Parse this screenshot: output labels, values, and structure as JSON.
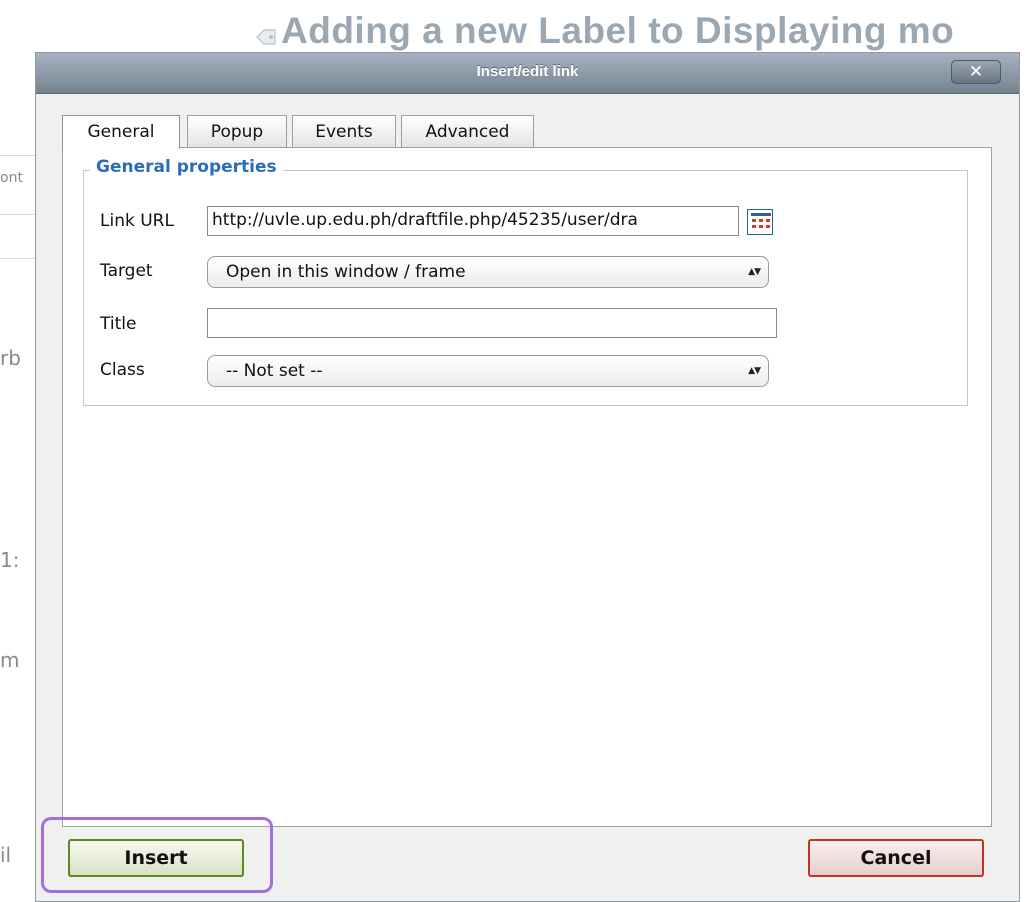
{
  "background": {
    "heading": "Adding a new Label to Displaying mo",
    "fragments": [
      "ont",
      "rb",
      "1:",
      "m",
      "il"
    ]
  },
  "dialog": {
    "title": "Insert/edit link",
    "close_label": "✕",
    "tabs": [
      "General",
      "Popup",
      "Events",
      "Advanced"
    ],
    "active_tab": "General",
    "fieldset_legend": "General properties",
    "fields": {
      "link_url": {
        "label": "Link URL",
        "value": "http://uvle.up.edu.ph/draftfile.php/45235/user/dra"
      },
      "target": {
        "label": "Target",
        "value": "Open in this window / frame"
      },
      "title": {
        "label": "Title",
        "value": ""
      },
      "class": {
        "label": "Class",
        "value": "-- Not set --"
      }
    },
    "buttons": {
      "insert": "Insert",
      "cancel": "Cancel"
    }
  },
  "colors": {
    "legend_blue": "#2b6db8",
    "insert_border": "#5c8a1f",
    "cancel_border": "#c0341f",
    "highlight": "#a46fe0"
  }
}
